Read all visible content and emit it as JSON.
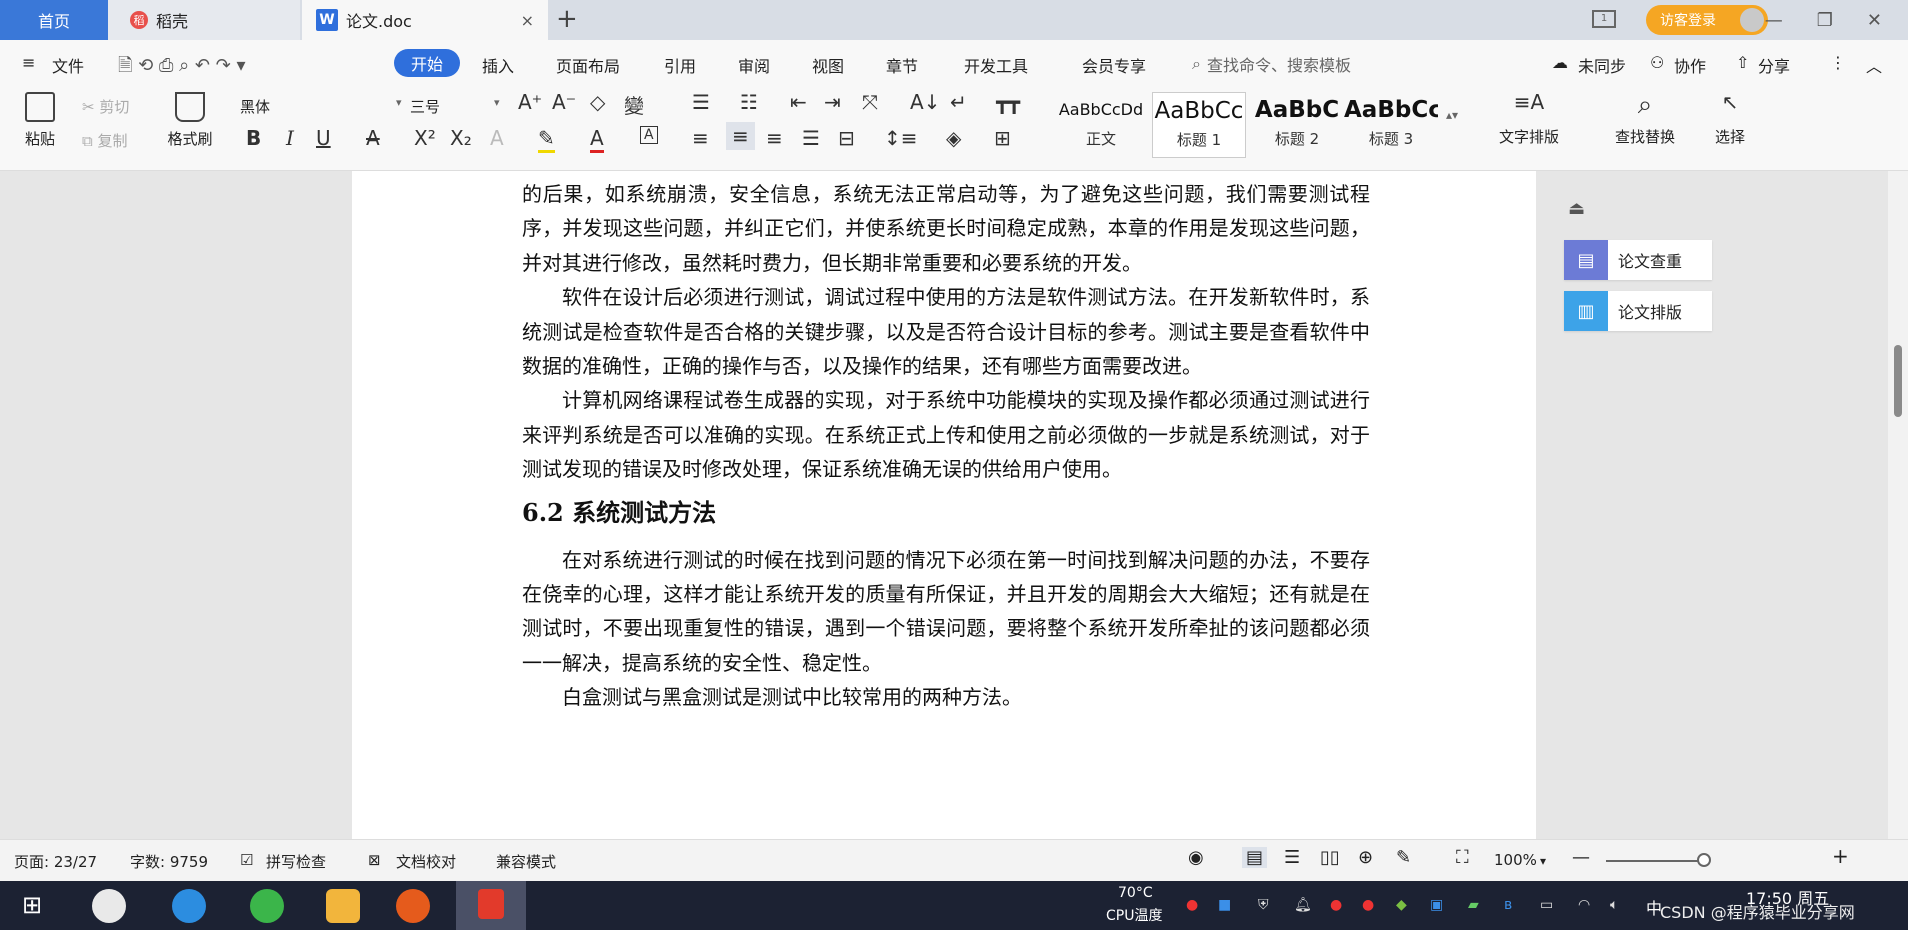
{
  "tabs": {
    "home": "首页",
    "daoke": "稻壳",
    "doc": "论文.doc",
    "close": "×",
    "new": "+"
  },
  "topbar": {
    "login": "访客登录",
    "minimize": "—",
    "restore": "❐",
    "close": "✕"
  },
  "menu": {
    "file": "文件",
    "items": [
      "开始",
      "插入",
      "页面布局",
      "引用",
      "审阅",
      "视图",
      "章节",
      "开发工具",
      "会员专享"
    ],
    "search_placeholder": "查找命令、搜索模板",
    "sync": "未同步",
    "collab": "协作",
    "share": "分享"
  },
  "ribbon": {
    "paste": "粘贴",
    "cut": "剪切",
    "copy": "复制",
    "format_painter": "格式刷",
    "font": "黑体",
    "size": "三号",
    "styles": [
      {
        "preview": "AaBbCcDd",
        "name": "正文"
      },
      {
        "preview": "AaBbCc",
        "name": "标题 1"
      },
      {
        "preview": "AaBbC",
        "name": "标题 2"
      },
      {
        "preview": "AaBbCc",
        "name": "标题 3"
      }
    ],
    "text_layout": "文字排版",
    "find_replace": "查找替换",
    "select": "选择"
  },
  "document": {
    "paragraphs": [
      {
        "indent": false,
        "text": "的后果，如系统崩溃，安全信息，系统无法正常启动等，为了避免这些问题，我们需要测试程序，并发现这些问题，并纠正它们，并使系统更长时间稳定成熟，本章的作用是发现这些问题，并对其进行修改，虽然耗时费力，但长期非常重要和必要系统的开发。"
      },
      {
        "indent": true,
        "text": "软件在设计后必须进行测试，调试过程中使用的方法是软件测试方法。在开发新软件时，系统测试是检查软件是否合格的关键步骤，以及是否符合设计目标的参考。测试主要是查看软件中数据的准确性，正确的操作与否，以及操作的结果，还有哪些方面需要改进。"
      },
      {
        "indent": true,
        "text": "计算机网络课程试卷生成器的实现，对于系统中功能模块的实现及操作都必须通过测试进行来评判系统是否可以准确的实现。在系统正式上传和使用之前必须做的一步就是系统测试，对于测试发现的错误及时修改处理，保证系统准确无误的供给用户使用。"
      }
    ],
    "heading": "6.2 系统测试方法",
    "paragraphs2": [
      {
        "indent": true,
        "text": "在对系统进行测试的时候在找到问题的情况下必须在第一时间找到解决问题的办法，不要存在侥幸的心理，这样才能让系统开发的质量有所保证，并且开发的周期会大大缩短；还有就是在测试时，不要出现重复性的错误，遇到一个错误问题，要将整个系统开发所牵扯的该问题都必须一一解决，提高系统的安全性、稳定性。"
      },
      {
        "indent": true,
        "text": "白盒测试与黑盒测试是测试中比较常用的两种方法。"
      }
    ]
  },
  "side_tools": {
    "check": "论文查重",
    "layout": "论文排版"
  },
  "status": {
    "page": "页面: 23/27",
    "words": "字数: 9759",
    "spell": "拼写检查",
    "proof": "文档校对",
    "compat": "兼容模式",
    "zoom": "100%",
    "zoom_level": 1.0
  },
  "taskbar": {
    "cpu_temp": "70°C",
    "cpu_label": "CPU温度",
    "ime": "中",
    "time": "17:50 周五",
    "watermark": "CSDN @程序猿毕业分享网"
  }
}
